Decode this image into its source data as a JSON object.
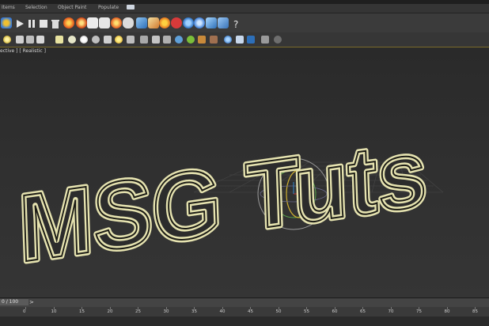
{
  "ribbon": {
    "tabs": [
      "Items",
      "Selection",
      "Object Paint",
      "Populate"
    ]
  },
  "viewport": {
    "label": "ective ] [ Realistic ]",
    "scene_text": "MSG Tuts",
    "outline_color": "#e6e3b0",
    "text_fill_color": "#2c2c2c"
  },
  "toolbar1": {
    "icons": [
      "select-icon",
      "play-icon",
      "pause-icon",
      "stop-icon",
      "trash-icon",
      "fire-icon",
      "fire-icon-2",
      "render-icon",
      "render-setup-icon",
      "teapot-icon",
      "cloud-icon",
      "render-frame-icon",
      "material-icon",
      "material-editor-icon",
      "stop-red-icon",
      "globe-icon",
      "compass-icon",
      "box-icon",
      "help-icon"
    ]
  },
  "toolbar2": {
    "icons": [
      "light-icon",
      "camera-icon",
      "helper-icon",
      "cube-icon",
      "sphere-icon",
      "plane-icon",
      "cone-icon",
      "geosphere-icon",
      "sun-icon",
      "wind-icon",
      "gravity-icon",
      "link-icon",
      "unlink-icon",
      "bind-icon",
      "leaf-icon",
      "particles-icon",
      "mirror-icon",
      "align-icon",
      "globe-icon-2",
      "render-icon-2",
      "stats-icon",
      "help-icon-2"
    ]
  },
  "timeline": {
    "frame_counter": "0 / 100",
    "next_button": ">",
    "ticks": [
      "0",
      "10",
      "15",
      "20",
      "25",
      "30",
      "35",
      "40",
      "45",
      "50",
      "55",
      "60",
      "65",
      "70",
      "75",
      "80",
      "85"
    ]
  }
}
